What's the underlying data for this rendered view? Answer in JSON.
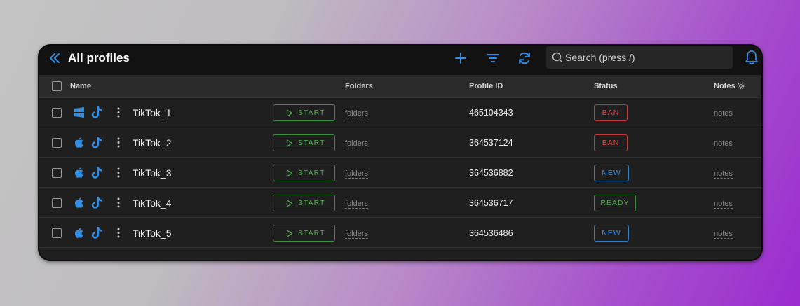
{
  "header": {
    "title": "All profiles",
    "search_placeholder": "Search (press /)"
  },
  "table": {
    "columns": {
      "name": "Name",
      "folders": "Folders",
      "profile_id": "Profile ID",
      "status": "Status",
      "notes": "Notes"
    },
    "start_label": "START",
    "folders_placeholder": "folders",
    "notes_placeholder": "notes",
    "rows": [
      {
        "os": "windows-icon",
        "app": "tiktok-icon",
        "name": "TikTok_1",
        "profile_id": "465104343",
        "status": "BAN"
      },
      {
        "os": "apple-icon",
        "app": "tiktok-icon",
        "name": "TikTok_2",
        "profile_id": "364537124",
        "status": "BAN"
      },
      {
        "os": "apple-icon",
        "app": "tiktok-icon",
        "name": "TikTok_3",
        "profile_id": "364536882",
        "status": "NEW"
      },
      {
        "os": "apple-icon",
        "app": "tiktok-icon",
        "name": "TikTok_4",
        "profile_id": "364536717",
        "status": "READY"
      },
      {
        "os": "apple-icon",
        "app": "tiktok-icon",
        "name": "TikTok_5",
        "profile_id": "364536486",
        "status": "NEW"
      }
    ]
  },
  "colors": {
    "accent": "#2f8fe6",
    "ban": "#e04b4b",
    "new": "#3d8fd6",
    "ready": "#4fb04f",
    "start": "#4fb04f"
  }
}
